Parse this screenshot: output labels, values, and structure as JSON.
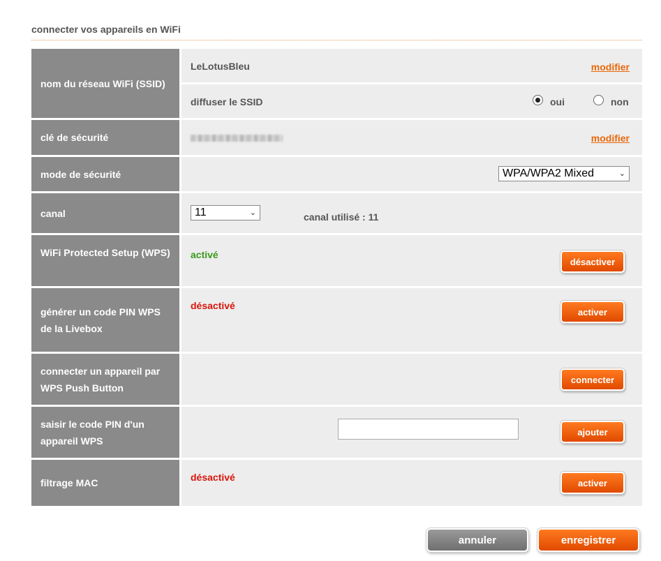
{
  "section_title": "connecter vos appareils en WiFi",
  "ssid": {
    "label": "nom du réseau WiFi (SSID)",
    "value": "LeLotusBleu",
    "modify_label": "modifier",
    "broadcast_label": "diffuser le SSID",
    "options": [
      {
        "label": "oui",
        "selected": true
      },
      {
        "label": "non",
        "selected": false
      }
    ]
  },
  "security_key": {
    "label": "clé de sécurité",
    "modify_label": "modifier"
  },
  "security_mode": {
    "label": "mode de sécurité",
    "selected": "WPA/WPA2 Mixed"
  },
  "channel": {
    "label": "canal",
    "selected": "11",
    "used_text": "canal utilisé : 11"
  },
  "wps": {
    "label": "WiFi Protected Setup (WPS)",
    "status": "activé",
    "button": "désactiver"
  },
  "wps_pin": {
    "label": "générer un code PIN WPS de la Livebox",
    "status": "désactivé",
    "button": "activer"
  },
  "wps_push": {
    "label": "connecter un appareil par WPS Push Button",
    "button": "connecter"
  },
  "device_pin": {
    "label": "saisir le code PIN d'un appareil WPS",
    "value": "",
    "button": "ajouter"
  },
  "mac_filter": {
    "label": "filtrage MAC",
    "status": "désactivé",
    "button": "activer"
  },
  "footer": {
    "cancel": "annuler",
    "save": "enregistrer"
  },
  "colors": {
    "accent": "#e8680a",
    "label_bg": "#8a8a8a",
    "value_bg": "#ededed",
    "active": "#3a9a1a",
    "inactive": "#d8150a"
  }
}
